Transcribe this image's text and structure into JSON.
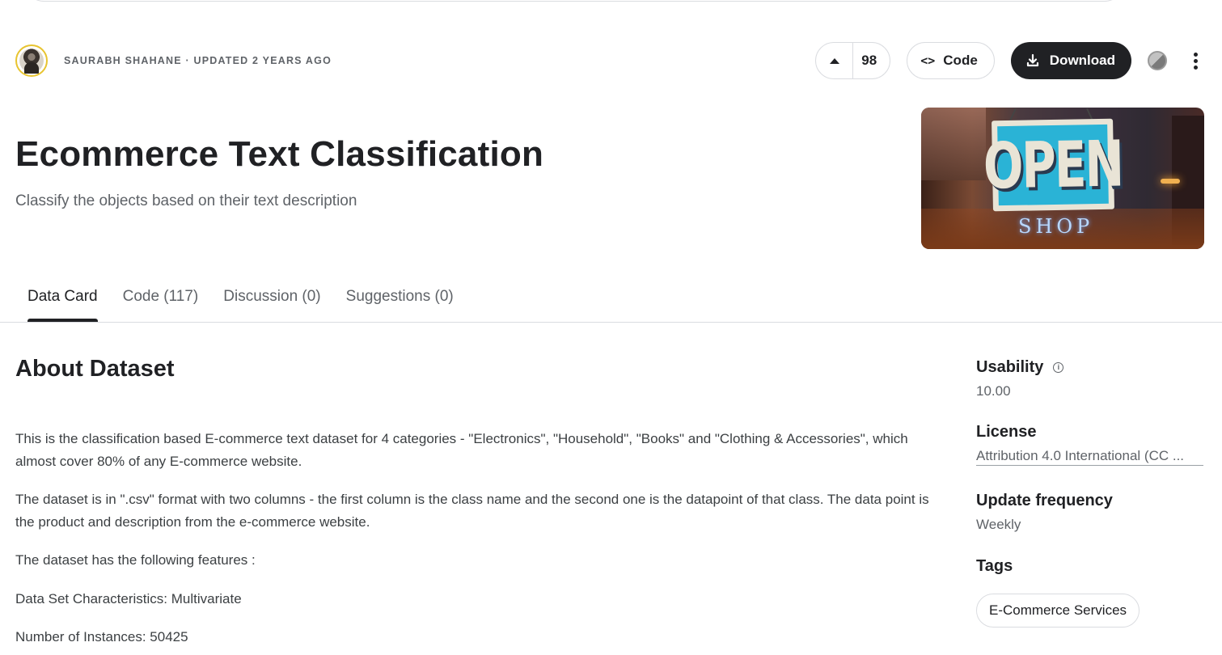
{
  "header": {
    "author_line": "SAURABH SHAHANE · UPDATED 2 YEARS AGO",
    "vote_count": "98",
    "code_button": "Code",
    "download_button": "Download"
  },
  "dataset": {
    "title": "Ecommerce Text Classification",
    "subtitle": "Classify the objects based on their text description",
    "banner_sign_word": "OPEN",
    "banner_shop_word": "SHOP"
  },
  "tabs": [
    {
      "label": "Data Card",
      "active": true
    },
    {
      "label": "Code (117)",
      "active": false
    },
    {
      "label": "Discussion (0)",
      "active": false
    },
    {
      "label": "Suggestions (0)",
      "active": false
    }
  ],
  "about": {
    "heading": "About Dataset",
    "paragraphs": [
      "This is the classification based E-commerce text dataset for 4 categories - \"Electronics\", \"Household\", \"Books\" and \"Clothing & Accessories\", which almost cover 80% of any E-commerce website.",
      "The dataset is in \".csv\" format with two columns - the first column is the class name and the second one is the datapoint of that class. The data point is the product and description from the e-commerce website.",
      "The dataset has the following features :",
      "Data Set Characteristics: Multivariate",
      "Number of Instances: 50425"
    ]
  },
  "sidebar": {
    "usability_label": "Usability",
    "usability_value": "10.00",
    "license_label": "License",
    "license_value": "Attribution 4.0 International (CC ...",
    "update_label": "Update frequency",
    "update_value": "Weekly",
    "tags_label": "Tags",
    "tags": [
      "E-Commerce Services"
    ]
  },
  "icons": {
    "upvote": "triangle-up-icon",
    "code": "code-brackets-icon",
    "download": "download-icon",
    "theme": "theme-toggle-icon",
    "more": "more-vertical-icon",
    "info": "info-icon"
  }
}
